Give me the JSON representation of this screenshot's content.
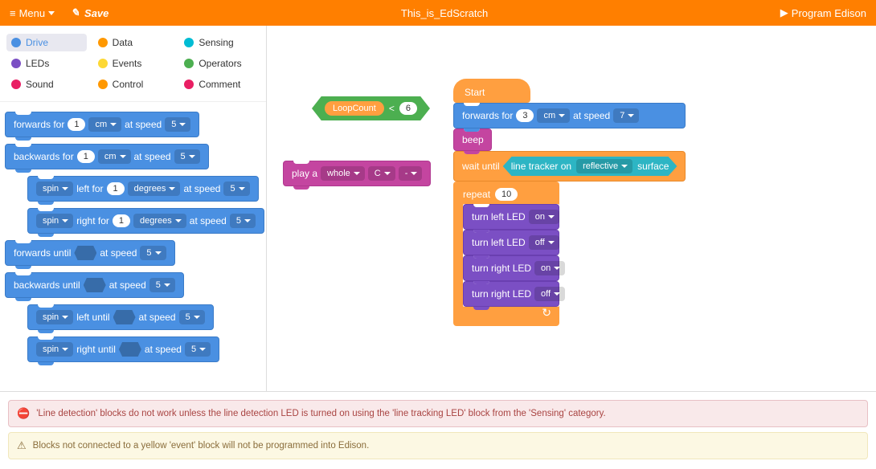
{
  "header": {
    "menu_label": "Menu",
    "save_label": "Save",
    "title": "This_is_EdScratch",
    "program_label": "Program Edison"
  },
  "categories": [
    {
      "id": "drive",
      "label": "Drive",
      "active": true
    },
    {
      "id": "leds",
      "label": "LEDs"
    },
    {
      "id": "sound",
      "label": "Sound"
    },
    {
      "id": "data",
      "label": "Data"
    },
    {
      "id": "events",
      "label": "Events"
    },
    {
      "id": "control",
      "label": "Control"
    },
    {
      "id": "sensing",
      "label": "Sensing"
    },
    {
      "id": "operators",
      "label": "Operators"
    },
    {
      "id": "comment",
      "label": "Comment"
    }
  ],
  "palette": {
    "forwards_for": {
      "label": "forwards for",
      "value": "1",
      "unit": "cm",
      "speed_label": "at speed",
      "speed": "5"
    },
    "backwards_for": {
      "label": "backwards for",
      "value": "1",
      "unit": "cm",
      "speed_label": "at speed",
      "speed": "5"
    },
    "spin_left": {
      "pre": "spin",
      "dir": "left for",
      "value": "1",
      "unit": "degrees",
      "speed_label": "at speed",
      "speed": "5"
    },
    "spin_right": {
      "pre": "spin",
      "dir": "right for",
      "value": "1",
      "unit": "degrees",
      "speed_label": "at speed",
      "speed": "5"
    },
    "forwards_until": {
      "label": "forwards until",
      "speed_label": "at speed",
      "speed": "5"
    },
    "backwards_until": {
      "label": "backwards until",
      "speed_label": "at speed",
      "speed": "5"
    },
    "spin_left_until": {
      "pre": "spin",
      "dir": "left until",
      "speed_label": "at speed",
      "speed": "5"
    },
    "spin_right_until": {
      "pre": "spin",
      "dir": "right until",
      "speed_label": "at speed",
      "speed": "5"
    }
  },
  "floating": {
    "compare": {
      "left": "LoopCount",
      "op": "<",
      "right": "6"
    },
    "play": {
      "label": "play a",
      "duration": "whole",
      "note": "C",
      "mod": "-"
    }
  },
  "program": {
    "start": "Start",
    "forwards": {
      "label": "forwards for",
      "value": "3",
      "unit": "cm",
      "speed_label": "at speed",
      "speed": "7"
    },
    "beep": "beep",
    "wait": {
      "label": "wait until",
      "sensor_pre": "line tracker on",
      "surface": "reflective",
      "sensor_post": "surface"
    },
    "repeat": {
      "label": "repeat",
      "count": "10"
    },
    "led_blocks": [
      {
        "label": "turn left LED",
        "state": "on"
      },
      {
        "label": "turn left LED",
        "state": "off"
      },
      {
        "label": "turn right LED",
        "state": "on"
      },
      {
        "label": "turn right LED",
        "state": "off"
      }
    ]
  },
  "tools": {
    "zoom_in": "⊕",
    "zoom_out": "⊖",
    "reset": "="
  },
  "alerts": {
    "error": "'Line detection' blocks do not work unless the line detection LED is turned on using the 'line tracking LED' block from the 'Sensing' category.",
    "warn": "Blocks not connected to a yellow 'event' block will not be programmed into Edison."
  }
}
